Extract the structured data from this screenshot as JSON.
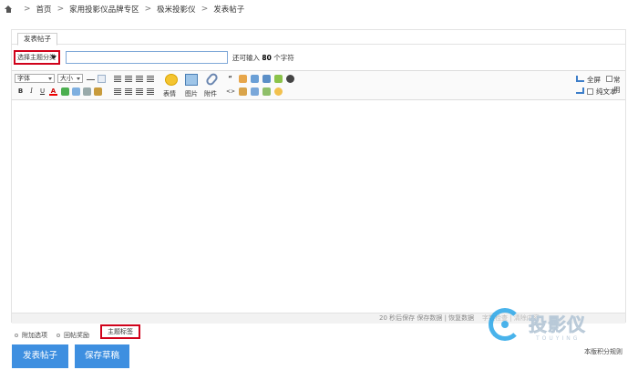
{
  "breadcrumb": {
    "items": [
      "首页",
      "家用投影仪品牌专区",
      "极米投影仪",
      "发表帖子"
    ],
    "separator": ">"
  },
  "tabs": [
    {
      "label": "发表帖子",
      "active": true
    }
  ],
  "subject": {
    "type_select_value": "选择主题分类",
    "placeholder": "",
    "remaining_prefix": "还可输入",
    "remaining_count": "80",
    "remaining_suffix": "个字符"
  },
  "toolbar": {
    "font_label": "字体",
    "size_label": "大小",
    "emoji_label": "表情",
    "image_label": "图片",
    "attach_label": "附件",
    "fullscreen_label": "全屏",
    "common_label": "常用",
    "plaintext_label": "纯文本",
    "bold": "B",
    "italic": "I",
    "underline": "U",
    "fontcolor": "A"
  },
  "editor": {
    "status_left": "20 秒后保存 保存数据 | 恢复数据",
    "status_right": "字数检查 | 清除内容"
  },
  "options": {
    "items": [
      "附加选项",
      "回帖奖励"
    ],
    "tag_label": "主题标签"
  },
  "buttons": {
    "post": "发表帖子",
    "draft": "保存草稿"
  },
  "footer": {
    "rules": "本版积分规则"
  },
  "watermark": {
    "text": "投影仪",
    "sub": "TOUYING"
  },
  "colors": {
    "accent": "#3e8fe0",
    "highlight": "#d0021b",
    "input_border": "#7fa8d8",
    "watermark": "#2aa6e8"
  },
  "icons": [
    "home-icon",
    "chevron-right-icon",
    "bold-icon",
    "italic-icon",
    "underline-icon",
    "font-color-icon",
    "emoji-icon",
    "image-icon",
    "attachment-icon",
    "undo-icon",
    "redo-icon",
    "checkbox-icon",
    "quote-icon",
    "code-icon"
  ]
}
